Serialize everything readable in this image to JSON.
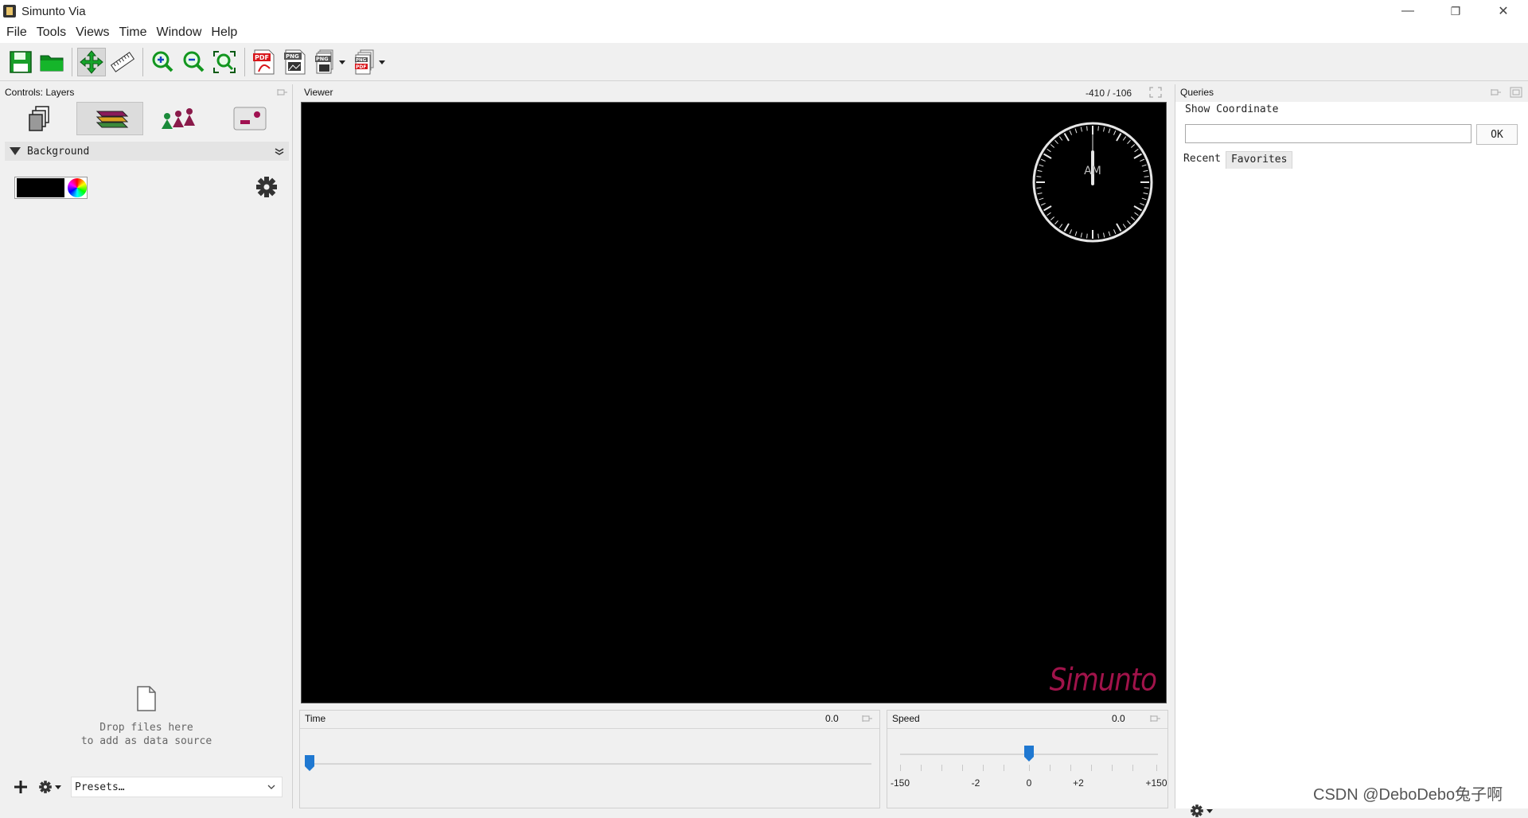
{
  "window": {
    "title": "Simunto Via",
    "controls": {
      "minimize": "—",
      "restore": "❐",
      "close": "✕"
    }
  },
  "menu": [
    "File",
    "Tools",
    "Views",
    "Time",
    "Window",
    "Help"
  ],
  "toolbar": {
    "buttons": [
      "save-icon",
      "open-folder-icon",
      "pan-move-icon",
      "ruler-icon",
      "zoom-in-icon",
      "zoom-out-icon",
      "zoom-fit-icon",
      "export-pdf-icon",
      "export-png-icon",
      "export-png-series-icon",
      "export-multi-icon"
    ],
    "active": "pan-move-icon"
  },
  "controls_panel": {
    "title": "Controls: Layers",
    "tabs": [
      "data-sources-icon",
      "layers-icon",
      "agents-icon",
      "toggle-icon"
    ],
    "active_tab": "layers-icon",
    "layer": {
      "name": "Background",
      "color": "#000000"
    },
    "drop_hint_line1": "Drop files here",
    "drop_hint_line2": "to add as data source",
    "presets": "Presets…"
  },
  "viewer": {
    "title": "Viewer",
    "coordinates": "-410 / -106",
    "clock_label": "AM",
    "brand": "Simunto"
  },
  "time_panel": {
    "title": "Time",
    "value": "0.0",
    "position": 0
  },
  "speed_panel": {
    "title": "Speed",
    "value": "0.0",
    "tick_labels": [
      "-150",
      "-2",
      "0",
      "+2",
      "+150"
    ],
    "position": 0.5
  },
  "queries_panel": {
    "title": "Queries",
    "label": "Show Coordinate",
    "input_value": "",
    "ok_label": "OK",
    "tabs": [
      "Recent",
      "Favorites"
    ],
    "active_tab": "Recent"
  },
  "watermark": "CSDN @DeboDebo兔子啊"
}
